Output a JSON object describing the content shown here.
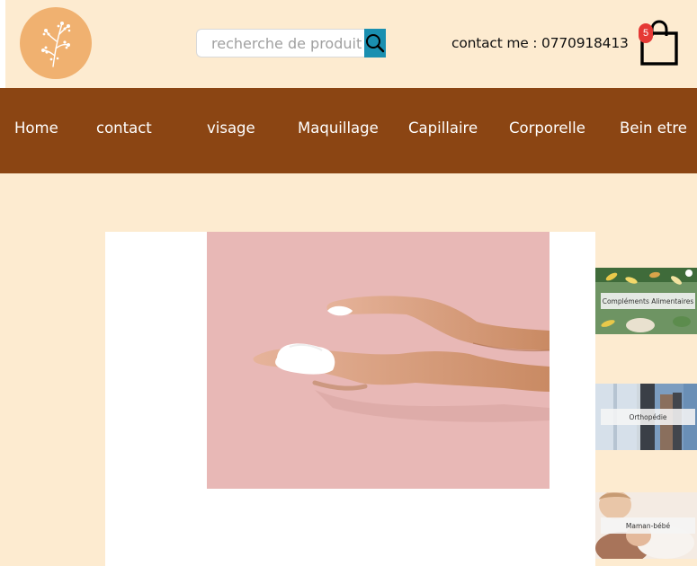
{
  "header": {
    "search": {
      "placeholder": "recherche de produit"
    },
    "contact": "contact me : 0770918413",
    "cart": {
      "count": "5"
    }
  },
  "nav": {
    "items": [
      {
        "label": "Home"
      },
      {
        "label": "contact"
      },
      {
        "label": "visage"
      },
      {
        "label": "Maquillage"
      },
      {
        "label": "Capillaire"
      },
      {
        "label": "Corporelle"
      },
      {
        "label": "Bein etre"
      }
    ]
  },
  "categories": [
    {
      "label": "Compléments Alimentaires"
    },
    {
      "label": "Orthopédie"
    },
    {
      "label": "Maman-bébé"
    }
  ],
  "colors": {
    "page_bg": "#fdebd0",
    "nav_bg": "#8b4513",
    "logo_bg": "#f0b170",
    "search_button": "#1a8fb0",
    "badge": "#e53935"
  }
}
